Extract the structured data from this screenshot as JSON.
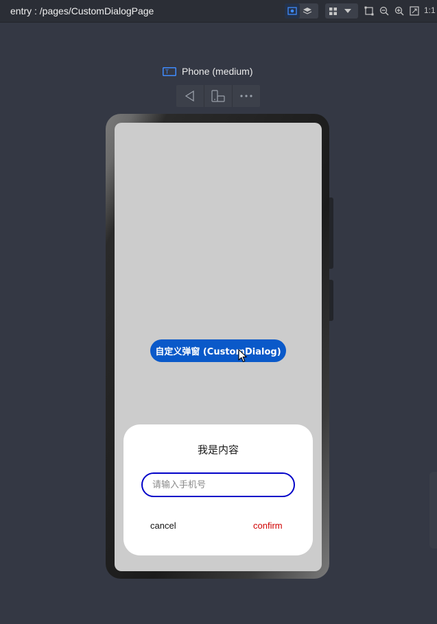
{
  "toolbar": {
    "path": "entry : /pages/CustomDialogPage",
    "ratio_label": "1:1"
  },
  "device": {
    "name": "Phone (medium)"
  },
  "screen": {
    "main_button": "自定义弹窗 (CustomDialog)"
  },
  "dialog": {
    "title": "我是内容",
    "input_placeholder": "请输入手机号",
    "input_value": "",
    "cancel_label": "cancel",
    "confirm_label": "confirm"
  },
  "colors": {
    "background": "#343844",
    "button": "#0a59c9",
    "input_border": "#0000c8",
    "confirm": "#d00000"
  }
}
